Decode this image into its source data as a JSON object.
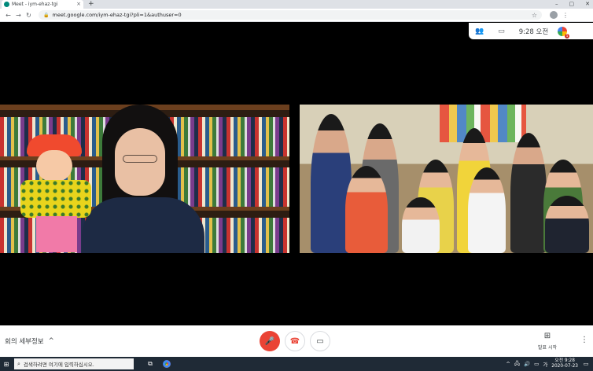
{
  "browser": {
    "tab_title": "Meet - iym-ehaz-tgi",
    "tab_close": "×",
    "new_tab": "+",
    "window_controls": [
      "–",
      "▢",
      "✕"
    ],
    "url": "meet.google.com/iym-ehaz-tgi?pli=1&authuser=0",
    "lock_icon": "🔒",
    "star_icon": "☆",
    "menu_icon": "⋮"
  },
  "meet_top": {
    "people_icon": "👥",
    "chat_icon": "▭",
    "clock": "9:28 오전",
    "badge": "5"
  },
  "participants": [
    {
      "id": "teacher"
    },
    {
      "id": "classroom"
    }
  ],
  "meet_bottom": {
    "details_label": "회의 세부정보",
    "details_chevron": "^",
    "mic_icon": "🎤",
    "hangup_icon": "☎",
    "camera_icon": "▭",
    "present_icon": "⊞",
    "present_label": "발표 시작",
    "more_icon": "⋮"
  },
  "taskbar": {
    "start_icon": "⊞",
    "search_icon": "⌕",
    "search_placeholder": "검색하려면 여기에 입력하십시오.",
    "taskview_icon": "⧉",
    "tray_chevron": "^",
    "tray_icons": [
      "🖧",
      "🔊",
      "▭"
    ],
    "input_lang": "가",
    "time": "오전 9:28",
    "date": "2020-07-23",
    "notification_icon": "▭"
  },
  "colors": {
    "mic_off": "#ea4335",
    "taskbar_bg": "#1f2a36",
    "chrome_bg": "#dee1e6"
  }
}
